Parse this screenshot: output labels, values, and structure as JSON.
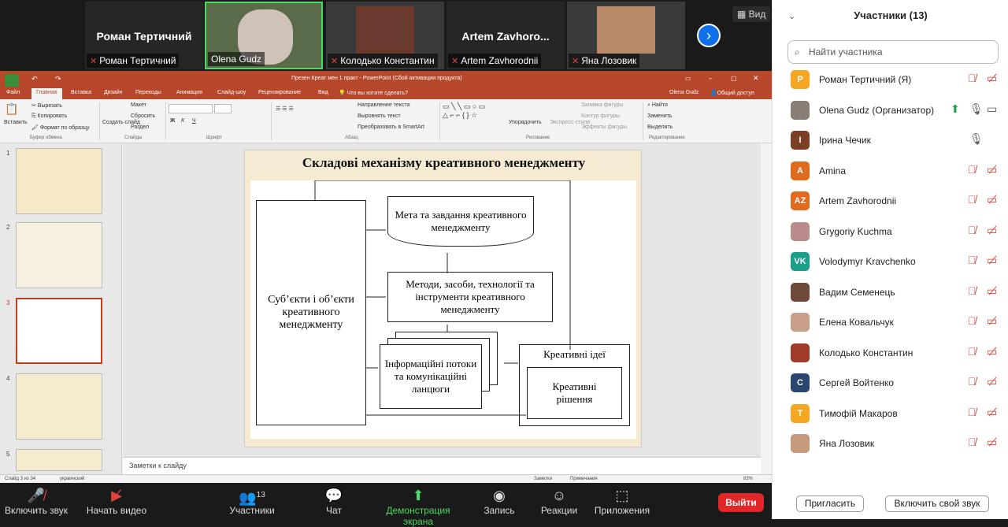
{
  "top_strip": {
    "view_label": "Вид",
    "tiles": [
      {
        "name": "Роман Тертичний",
        "label": "Роман Тертичний",
        "mic_muted": true,
        "has_video": false
      },
      {
        "name": "",
        "label": "Olena Gudz",
        "mic_muted": false,
        "has_video": true
      },
      {
        "name": "",
        "label": "Колодько Константин",
        "mic_muted": true,
        "has_video": true
      },
      {
        "name": "Artem  Zavhoro...",
        "label": "Artem Zavhorodnii",
        "mic_muted": true,
        "has_video": false
      },
      {
        "name": "",
        "label": "Яна Лозовик",
        "mic_muted": true,
        "has_video": true
      }
    ]
  },
  "ppt": {
    "title": "Презен Креат мен 1 практ - PowerPoint (Сбой активации продукта)",
    "user": "Olena Gudz",
    "share": "Общий доступ",
    "tabs": [
      "Файл",
      "Главная",
      "Вставка",
      "Дизайн",
      "Переходы",
      "Анимация",
      "Слайд-шоу",
      "Рецензирование",
      "Вид"
    ],
    "tell_me": "Что вы хотите сделать?",
    "ribbon": {
      "paste": "Вставить",
      "cut": "Вырезать",
      "copy": "Копировать",
      "format": "Формат по образцу",
      "new_slide": "Создать слайд",
      "layout": "Макет",
      "reset": "Сбросить",
      "section": "Раздел",
      "text_dir": "Направление текста",
      "align_text": "Выровнять текст",
      "smartart": "Преобразовать в SmartArt",
      "arrange": "Упорядочить",
      "quick_styles": "Экспресс-стили",
      "fill": "Заливка фигуры",
      "outline": "Контур фигуры",
      "effects": "Эффекты фигуры",
      "find": "Найти",
      "replace": "Заменить",
      "select": "Выделить",
      "groups": [
        "Буфер обмена",
        "Слайды",
        "Шрифт",
        "Абзац",
        "Рисование",
        "Редактирование"
      ]
    },
    "thumbs": [
      "1",
      "2",
      "3",
      "4",
      "5"
    ],
    "notes": "Заметки к слайду",
    "status_left": "Слайд 3 из 34",
    "status_lang": "украинский",
    "status_notes": "Заметки",
    "status_comments": "Примечания",
    "zoom": "83%",
    "slide": {
      "title": "Складові механізму креативного менеджменту",
      "subject": "Суб’єкти і об’єкти креативного менеджменту",
      "goal": "Мета та завдання креативного менеджменту",
      "methods": "Методи, засоби, технології та інструменти креативного менеджменту",
      "info": "Інформаційні потоки та комунікаційні ланцюги",
      "ideas": "Креативні ідеї",
      "decisions": "Креативні рішення"
    }
  },
  "toolbar": {
    "audio": "Включить звук",
    "video": "Начать видео",
    "participants": "Участники",
    "participants_count": "13",
    "chat": "Чат",
    "share": "Демонстрация экрана",
    "record": "Запись",
    "reactions": "Реакции",
    "apps": "Приложения",
    "leave": "Выйти"
  },
  "panel": {
    "title": "Участники (13)",
    "search_placeholder": "Найти участника",
    "invite": "Пригласить",
    "unmute": "Включить свой звук",
    "participants": [
      {
        "initials": "Р",
        "name": "Роман Тертичний (Я)",
        "color": "#f5a623",
        "mic": "muted",
        "video": "off"
      },
      {
        "initials": "",
        "name": "Olena Gudz (Организатор)",
        "color": "#8a7f76",
        "mic": "on",
        "video": "on"
      },
      {
        "initials": "I",
        "name": "Ірина Чечик",
        "color": "#7a3f25",
        "mic": "on-gray",
        "video": "none"
      },
      {
        "initials": "A",
        "name": "Amina",
        "color": "#e06b1f",
        "mic": "muted",
        "video": "off"
      },
      {
        "initials": "AZ",
        "name": "Artem Zavhorodnii",
        "color": "#e06b1f",
        "mic": "muted",
        "video": "off"
      },
      {
        "initials": "",
        "name": "Grygoriy Kuchma",
        "color": "#b88a8a",
        "mic": "muted",
        "video": "off"
      },
      {
        "initials": "VK",
        "name": "Volodymyr Kravchenko",
        "color": "#19a089",
        "mic": "muted",
        "video": "off"
      },
      {
        "initials": "",
        "name": "Вадим Семенець",
        "color": "#6e4a3a",
        "mic": "muted",
        "video": "off"
      },
      {
        "initials": "",
        "name": "Елена Ковальчук",
        "color": "#c89f8a",
        "mic": "muted",
        "video": "off"
      },
      {
        "initials": "",
        "name": "Колодько Константин",
        "color": "#a03a2a",
        "mic": "muted",
        "video": "off"
      },
      {
        "initials": "C",
        "name": "Сергей Войтенко",
        "color": "#2a4670",
        "mic": "muted",
        "video": "off"
      },
      {
        "initials": "T",
        "name": "Тимофій Макаров",
        "color": "#f5a623",
        "mic": "muted",
        "video": "off"
      },
      {
        "initials": "",
        "name": "Яна Лозовик",
        "color": "#c49a7a",
        "mic": "muted",
        "video": "off"
      }
    ]
  }
}
